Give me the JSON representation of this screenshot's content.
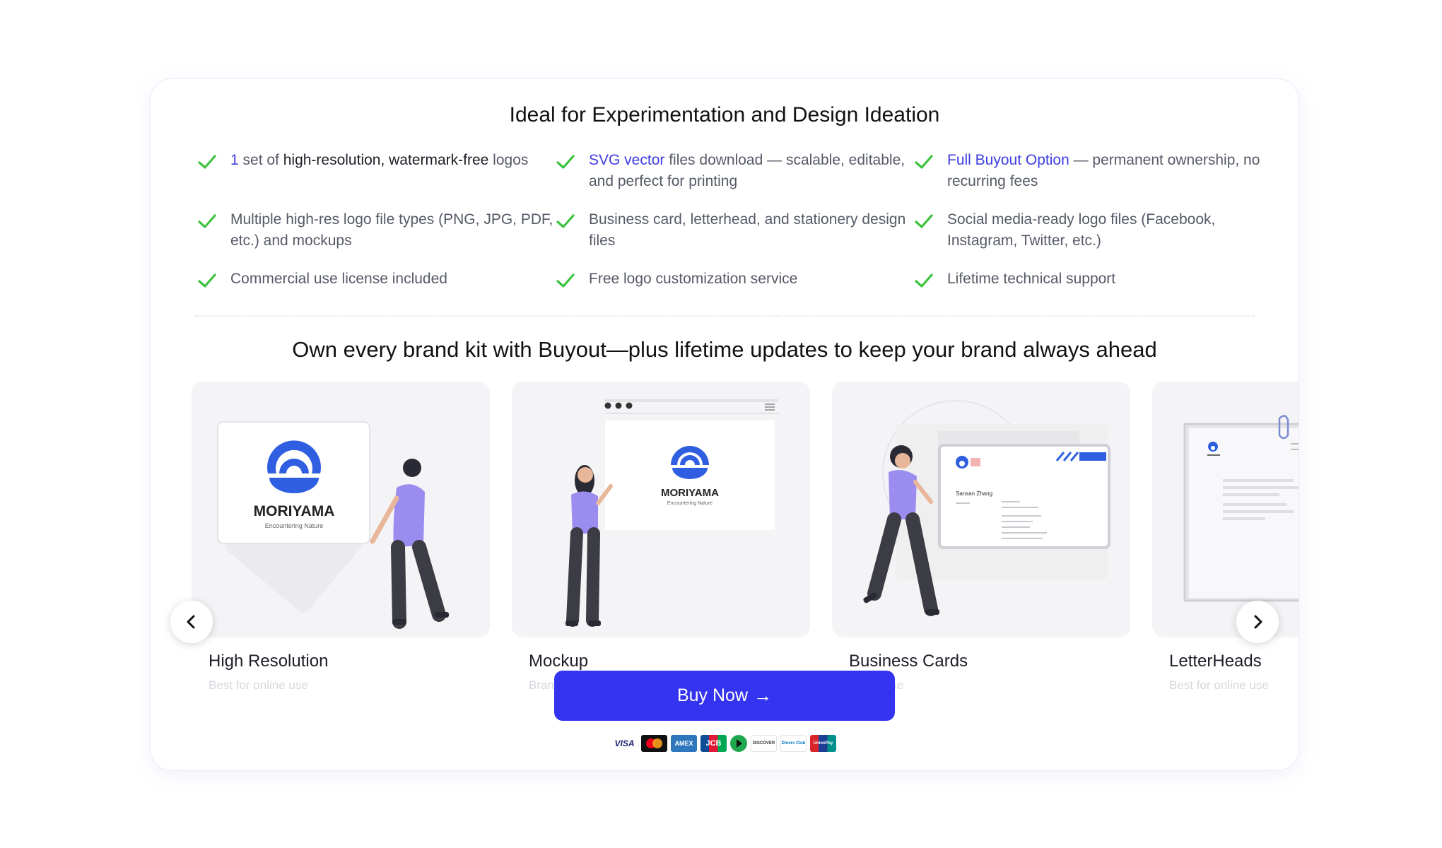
{
  "section1": {
    "title": "Ideal for Experimentation and Design Ideation",
    "features": [
      {
        "parts": [
          {
            "text": "1",
            "style": "hl"
          },
          {
            "text": " set of ",
            "style": ""
          },
          {
            "text": "high-resolution, watermark-free",
            "style": "dk"
          },
          {
            "text": " logos",
            "style": ""
          }
        ]
      },
      {
        "parts": [
          {
            "text": "SVG vector",
            "style": "hl"
          },
          {
            "text": " files download — scalable, editable, and perfect for printing",
            "style": ""
          }
        ]
      },
      {
        "parts": [
          {
            "text": "Full Buyout Option",
            "style": "hl"
          },
          {
            "text": " — permanent ownership, no recurring fees",
            "style": ""
          }
        ]
      },
      {
        "parts": [
          {
            "text": "Multiple high-res logo file types (PNG, JPG, PDF, etc.) and mockups",
            "style": ""
          }
        ]
      },
      {
        "parts": [
          {
            "text": "Business card, letterhead, and stationery design files",
            "style": ""
          }
        ]
      },
      {
        "parts": [
          {
            "text": "Social media-ready logo files (Facebook, Instagram, Twitter, etc.)",
            "style": ""
          }
        ]
      },
      {
        "parts": [
          {
            "text": "Commercial use license included",
            "style": ""
          }
        ]
      },
      {
        "parts": [
          {
            "text": "Free logo customization service",
            "style": ""
          }
        ]
      },
      {
        "parts": [
          {
            "text": "Lifetime technical support",
            "style": ""
          }
        ]
      }
    ]
  },
  "section2": {
    "title": "Own every brand kit with Buyout—plus lifetime updates to keep your brand always ahead"
  },
  "slides": [
    {
      "title": "High Resolution",
      "subtitle": "Best for online use",
      "brand": "MORIYAMA",
      "tagline": "Encountering Nature"
    },
    {
      "title": "Mockup",
      "subtitle": "Bran",
      "brand": "MORIYAMA",
      "tagline": "Encountering Nature"
    },
    {
      "title": "Business Cards",
      "subtitle": "online use",
      "name": "Sansan Zhang"
    },
    {
      "title": "LetterHeads",
      "subtitle": "Best for online use"
    }
  ],
  "buy_button": {
    "label": "Buy Now",
    "arrow": "→"
  },
  "payments": [
    "VISA",
    "mastercard",
    "AMEX",
    "JCB",
    "play",
    "DISCOVER",
    "Diners Club",
    "UnionPay"
  ],
  "colors": {
    "accent": "#3434f0",
    "highlight": "#3d3de0",
    "check": "#3cc23c"
  }
}
